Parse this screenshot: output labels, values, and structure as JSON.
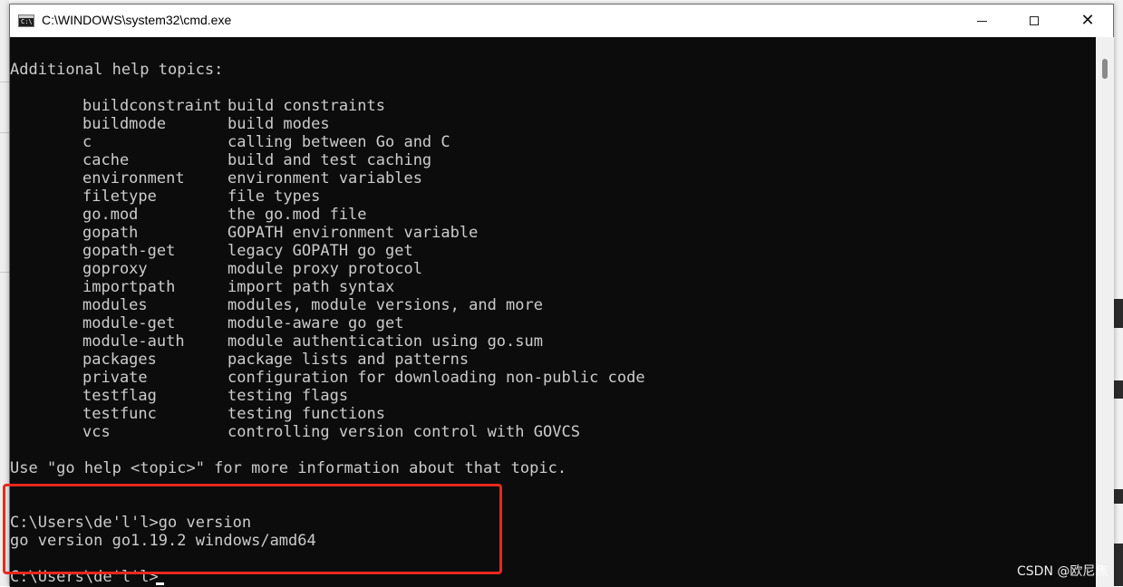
{
  "window": {
    "title": "C:\\WINDOWS\\system32\\cmd.exe",
    "icon_label": "C:\\",
    "controls": {
      "minimize": "minimize",
      "maximize": "maximize",
      "close": "✕"
    }
  },
  "console": {
    "header": "Additional help topics:",
    "topics": [
      {
        "name": "buildconstraint",
        "desc": "build constraints"
      },
      {
        "name": "buildmode",
        "desc": "build modes"
      },
      {
        "name": "c",
        "desc": "calling between Go and C"
      },
      {
        "name": "cache",
        "desc": "build and test caching"
      },
      {
        "name": "environment",
        "desc": "environment variables"
      },
      {
        "name": "filetype",
        "desc": "file types"
      },
      {
        "name": "go.mod",
        "desc": "the go.mod file"
      },
      {
        "name": "gopath",
        "desc": "GOPATH environment variable"
      },
      {
        "name": "gopath-get",
        "desc": "legacy GOPATH go get"
      },
      {
        "name": "goproxy",
        "desc": "module proxy protocol"
      },
      {
        "name": "importpath",
        "desc": "import path syntax"
      },
      {
        "name": "modules",
        "desc": "modules, module versions, and more"
      },
      {
        "name": "module-get",
        "desc": "module-aware go get"
      },
      {
        "name": "module-auth",
        "desc": "module authentication using go.sum"
      },
      {
        "name": "packages",
        "desc": "package lists and patterns"
      },
      {
        "name": "private",
        "desc": "configuration for downloading non-public code"
      },
      {
        "name": "testflag",
        "desc": "testing flags"
      },
      {
        "name": "testfunc",
        "desc": "testing functions"
      },
      {
        "name": "vcs",
        "desc": "controlling version control with GOVCS"
      }
    ],
    "footer": "Use \"go help <topic>\" for more information about that topic.",
    "command_line": "C:\\Users\\de'l'l>go version",
    "output_line": "go version go1.19.2 windows/amd64",
    "prompt_line": "C:\\Users\\de'l'l>"
  },
  "watermark": "CSDN @欧尼焦",
  "colors": {
    "console_bg": "#0c0c0c",
    "console_fg": "#cccccc",
    "highlight": "#e8281e"
  }
}
